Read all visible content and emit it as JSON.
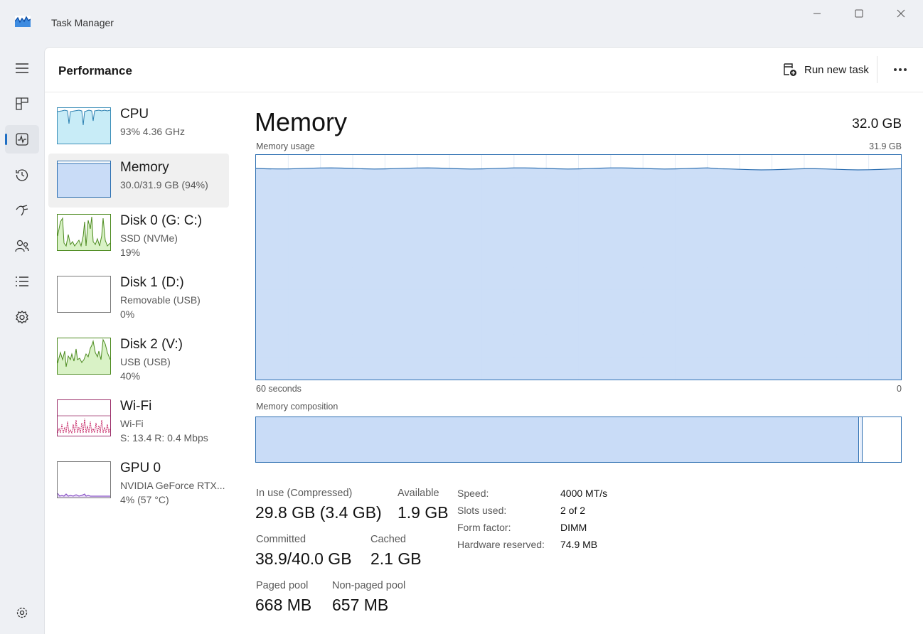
{
  "window": {
    "title": "Task Manager"
  },
  "colors": {
    "accent": "#1f6fc4",
    "memory_fill": "#c9dcf7",
    "memory_line": "#2d6fb1",
    "cpu_fill": "#c8ecf7",
    "disk_fill": "#d9f2c6",
    "disk_line": "#4c8a1f",
    "wifi_line": "#c2185b",
    "gpu_line": "#7b3fbf"
  },
  "nav": {
    "items": [
      {
        "icon": "hamburger-icon"
      },
      {
        "icon": "processes-icon"
      },
      {
        "icon": "performance-icon",
        "active": true
      },
      {
        "icon": "app-history-icon"
      },
      {
        "icon": "startup-apps-icon"
      },
      {
        "icon": "users-icon"
      },
      {
        "icon": "details-icon"
      },
      {
        "icon": "services-icon"
      },
      {
        "icon": "settings-icon"
      }
    ]
  },
  "header": {
    "title": "Performance",
    "run_new_task_label": "Run new task"
  },
  "devices": [
    {
      "name": "CPU",
      "line1": "93%  4.36 GHz",
      "line2": ""
    },
    {
      "name": "Memory",
      "line1": "30.0/31.9 GB (94%)",
      "line2": ""
    },
    {
      "name": "Disk 0 (G: C:)",
      "line1": "SSD (NVMe)",
      "line2": "19%"
    },
    {
      "name": "Disk 1 (D:)",
      "line1": "Removable (USB)",
      "line2": "0%"
    },
    {
      "name": "Disk 2 (V:)",
      "line1": "USB (USB)",
      "line2": "40%"
    },
    {
      "name": "Wi-Fi",
      "line1": "Wi-Fi",
      "line2": "S: 13.4  R: 0.4 Mbps"
    },
    {
      "name": "GPU 0",
      "line1": "NVIDIA GeForce RTX...",
      "line2": "4%  (57 °C)"
    }
  ],
  "memory": {
    "title": "Memory",
    "total": "32.0 GB",
    "usage_label": "Memory usage",
    "usage_max": "31.9 GB",
    "time_start": "60 seconds",
    "time_end": "0",
    "composition_label": "Memory composition",
    "usage_percent": 94,
    "stats": {
      "in_use_label": "In use (Compressed)",
      "in_use_value": "29.8 GB (3.4 GB)",
      "available_label": "Available",
      "available_value": "1.9 GB",
      "committed_label": "Committed",
      "committed_value": "38.9/40.0 GB",
      "cached_label": "Cached",
      "cached_value": "2.1 GB",
      "paged_label": "Paged pool",
      "paged_value": "668 MB",
      "nonpaged_label": "Non-paged pool",
      "nonpaged_value": "657 MB"
    },
    "specs": {
      "speed_label": "Speed:",
      "speed_value": "4000 MT/s",
      "slots_label": "Slots used:",
      "slots_value": "2 of 2",
      "form_label": "Form factor:",
      "form_value": "DIMM",
      "reserved_label": "Hardware reserved:",
      "reserved_value": "74.9 MB"
    }
  }
}
